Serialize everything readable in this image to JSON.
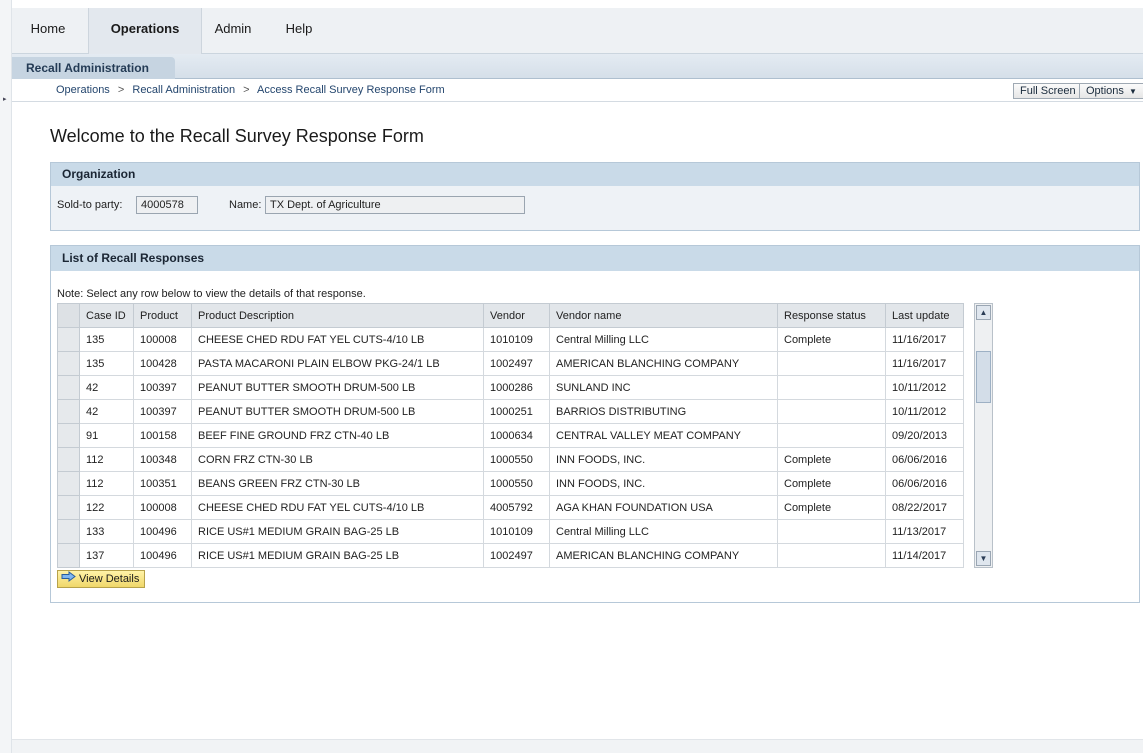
{
  "nav": {
    "tabs": [
      "Home",
      "Operations",
      "Admin",
      "Help"
    ]
  },
  "subnav": {
    "active": "Recall Administration"
  },
  "breadcrumb": {
    "items": [
      "Operations",
      "Recall Administration",
      "Access Recall Survey Response Form"
    ],
    "separator": ">"
  },
  "header_buttons": {
    "full_screen": "Full Screen",
    "options": "Options"
  },
  "page": {
    "title": "Welcome to the Recall Survey Response Form"
  },
  "organization": {
    "heading": "Organization",
    "sold_to_label": "Sold-to party:",
    "sold_to_value": "4000578",
    "name_label": "Name:",
    "name_value": "TX Dept. of Agriculture"
  },
  "responses": {
    "heading": "List of Recall Responses",
    "note": "Note: Select any row below to view the details of that response.",
    "columns": [
      "Case ID",
      "Product",
      "Product Description",
      "Vendor",
      "Vendor name",
      "Response status",
      "Last update"
    ],
    "rows": [
      [
        "135",
        "100008",
        "CHEESE CHED RDU FAT YEL CUTS-4/10 LB",
        "1010109",
        "Central Milling LLC",
        "Complete",
        "11/16/2017"
      ],
      [
        "135",
        "100428",
        "PASTA MACARONI PLAIN ELBOW PKG-24/1 LB",
        "1002497",
        "AMERICAN BLANCHING COMPANY",
        "",
        "11/16/2017"
      ],
      [
        "42",
        "100397",
        "PEANUT BUTTER SMOOTH DRUM-500 LB",
        "1000286",
        "SUNLAND INC",
        "",
        "10/11/2012"
      ],
      [
        "42",
        "100397",
        "PEANUT BUTTER SMOOTH DRUM-500 LB",
        "1000251",
        "BARRIOS DISTRIBUTING",
        "",
        "10/11/2012"
      ],
      [
        "91",
        "100158",
        "BEEF FINE GROUND FRZ CTN-40 LB",
        "1000634",
        "CENTRAL VALLEY MEAT COMPANY",
        "",
        "09/20/2013"
      ],
      [
        "112",
        "100348",
        "CORN FRZ CTN-30 LB",
        "1000550",
        "INN FOODS, INC.",
        "Complete",
        "06/06/2016"
      ],
      [
        "112",
        "100351",
        "BEANS GREEN FRZ CTN-30 LB",
        "1000550",
        "INN FOODS, INC.",
        "Complete",
        "06/06/2016"
      ],
      [
        "122",
        "100008",
        "CHEESE CHED RDU FAT YEL CUTS-4/10 LB",
        "4005792",
        "AGA KHAN FOUNDATION USA",
        "Complete",
        "08/22/2017"
      ],
      [
        "133",
        "100496",
        "RICE US#1 MEDIUM GRAIN BAG-25 LB",
        "1010109",
        "Central Milling LLC",
        "",
        "11/13/2017"
      ],
      [
        "137",
        "100496",
        "RICE US#1 MEDIUM GRAIN BAG-25 LB",
        "1002497",
        "AMERICAN BLANCHING COMPANY",
        "",
        "11/14/2017"
      ]
    ],
    "view_details_label": "View Details"
  },
  "icons": {
    "options_caret": "caret-down-icon",
    "view_details": "arrow-right-icon",
    "scroll_up": "scroll-up-icon",
    "scroll_down": "scroll-down-icon"
  }
}
